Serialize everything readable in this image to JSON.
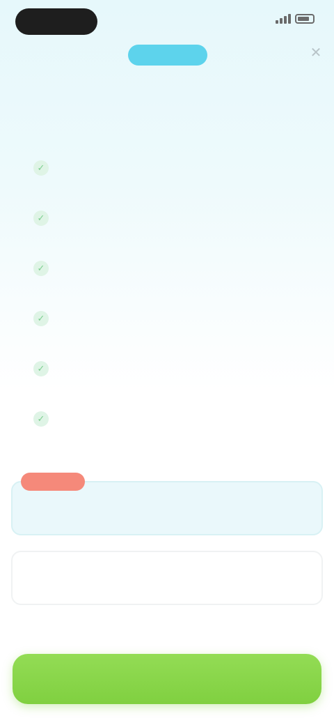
{
  "status_bar": {
    "time": "",
    "signal_icon": "signal-icon",
    "battery_icon": "battery-icon"
  },
  "close_icon": "close-icon",
  "header": {
    "badge": "",
    "title": "",
    "subtitle": ""
  },
  "features": [
    {
      "icon": "check-icon",
      "title": "",
      "description": ""
    },
    {
      "icon": "check-icon",
      "title": "",
      "description": ""
    },
    {
      "icon": "check-icon",
      "title": "",
      "description": ""
    },
    {
      "icon": "check-icon",
      "title": "",
      "description": ""
    },
    {
      "icon": "check-icon",
      "title": "",
      "description": ""
    },
    {
      "icon": "check-icon",
      "title": "",
      "description": ""
    }
  ],
  "plans": {
    "badge": "",
    "yearly": {
      "name": "",
      "price": ""
    },
    "monthly": {
      "name": "",
      "price": ""
    }
  },
  "terms": "",
  "cta": {
    "label": ""
  },
  "colors": {
    "accent": "#5dd3ec",
    "cta_green": "#88d448",
    "badge_coral": "#f5897a",
    "check_green": "#7ccf8f"
  }
}
